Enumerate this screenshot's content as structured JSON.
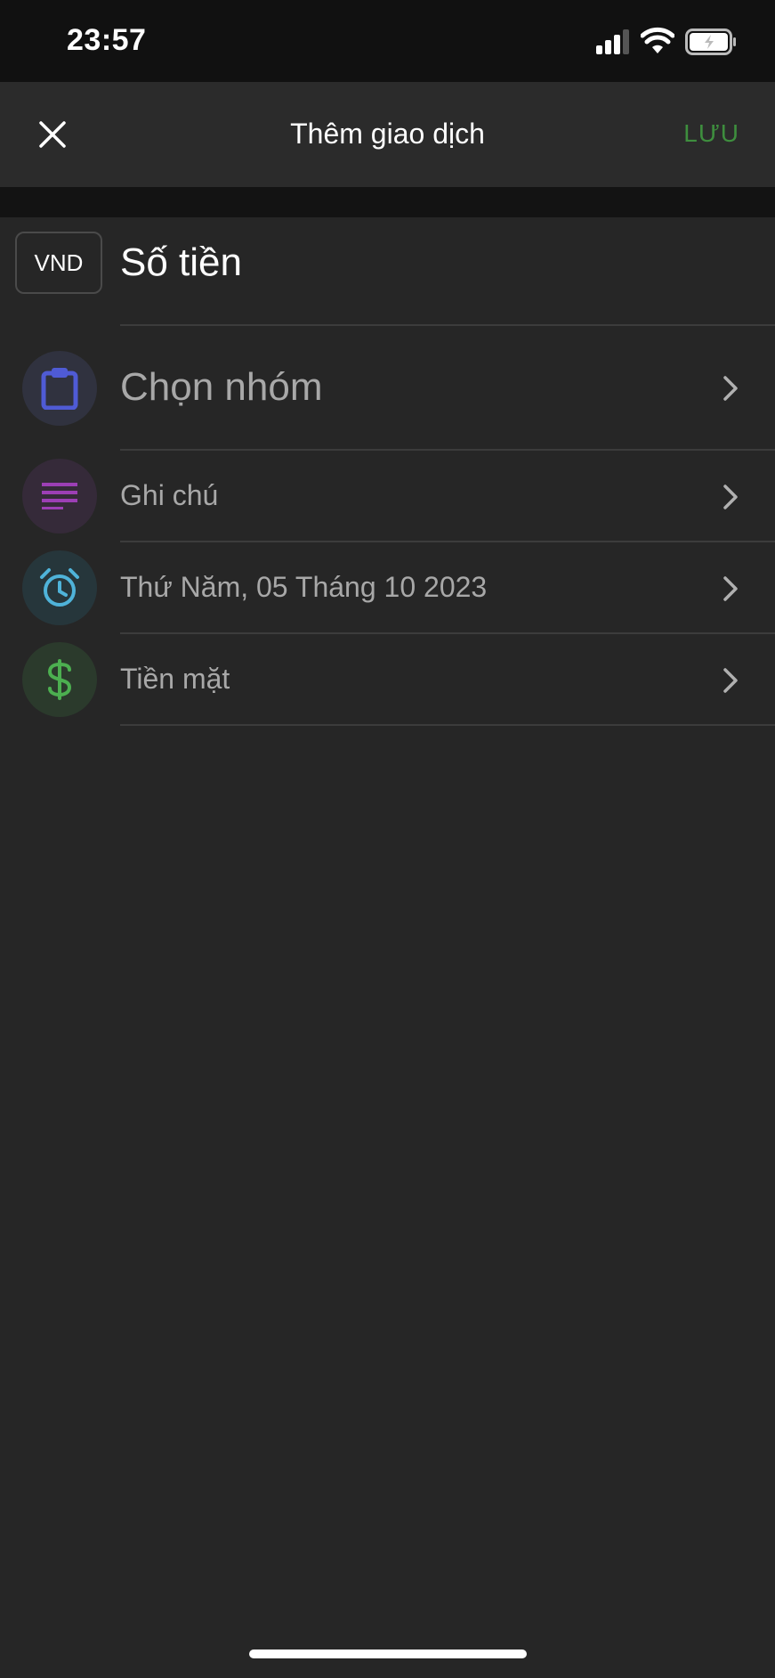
{
  "status_bar": {
    "time": "23:57",
    "icons": [
      "signal-icon",
      "wifi-icon",
      "battery-icon"
    ]
  },
  "header": {
    "close_icon": "close-icon",
    "title": "Thêm giao dịch",
    "save_label": "LƯU"
  },
  "amount": {
    "currency": "VND",
    "placeholder": "Số tiền"
  },
  "rows": [
    {
      "label": "Chọn nhóm",
      "icon": "clipboard-icon",
      "color": "#4f5bd5",
      "bg": "#30323f"
    },
    {
      "label": "Ghi chú",
      "icon": "notes-icon",
      "color": "#9c3fb5",
      "bg": "#352a39"
    },
    {
      "label": "Thứ Năm, 05 Tháng 10 2023",
      "icon": "alarm-clock-icon",
      "color": "#4fb3d9",
      "bg": "#26363b"
    },
    {
      "label": "Tiền mặt",
      "icon": "dollar-icon",
      "color": "#4caf50",
      "bg": "#2b3a2c"
    }
  ],
  "colors": {
    "background": "#262626",
    "header": "#2b2b2b",
    "status_bar": "#111111",
    "save_accent": "#3e8e3e"
  }
}
